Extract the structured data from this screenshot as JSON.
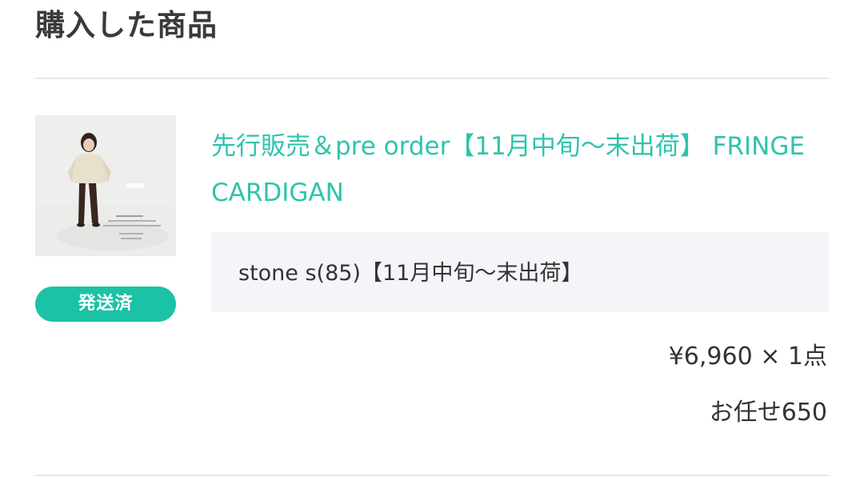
{
  "section": {
    "title": "購入した商品"
  },
  "order_item": {
    "thumbnail_icon": "product-photo-girl-cardigan",
    "status_badge": "発送済",
    "product_title": "先行販売＆pre order【11月中旬〜末出荷】 FRINGE CARDIGAN",
    "variant": "stone s(85)【11月中旬〜末出荷】",
    "price_quantity": "¥6,960 × 1点",
    "shipping_option": "お任せ650"
  },
  "colors": {
    "accent": "#2ec4ac",
    "badge_bg": "#1cc2a5",
    "variant_bg": "#f4f5f8",
    "text": "#333333"
  }
}
